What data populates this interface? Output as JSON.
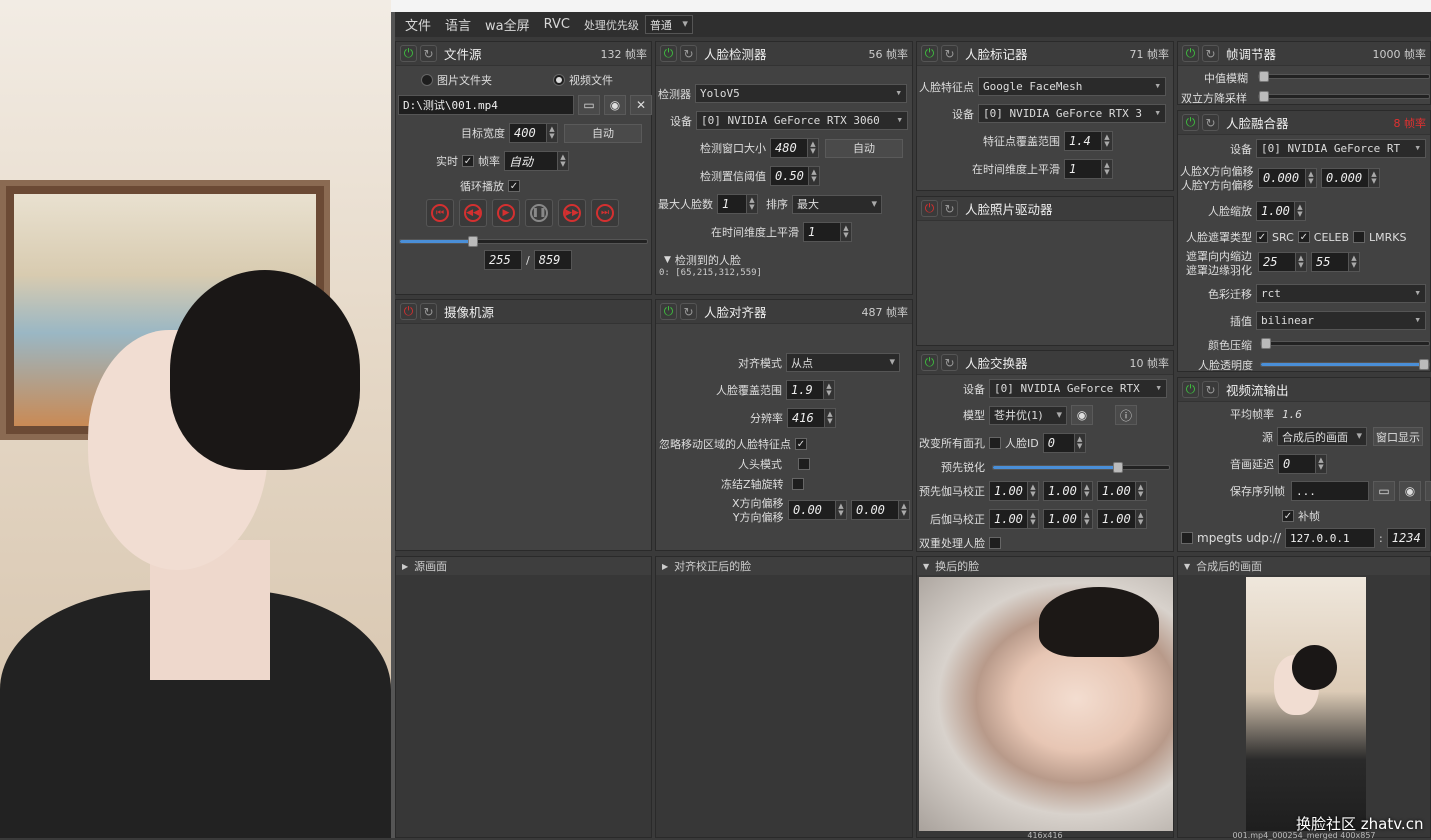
{
  "menu": {
    "items": [
      "文件",
      "语言",
      "wa全屏",
      "RVC"
    ],
    "priority_label": "处理优先级",
    "priority_value": "普通"
  },
  "file_source": {
    "title": "文件源",
    "fps": "132 帧率",
    "radio_folder": "图片文件夹",
    "radio_video": "视频文件",
    "path": "D:\\测试\\001.mp4",
    "target_width_label": "目标宽度",
    "target_width": "400",
    "auto_label": "自动",
    "realtime_label": "实时",
    "fps_label": "帧率",
    "fps_value": "自动",
    "loop_label": "循环播放",
    "frame_current": "255",
    "frame_total": "859",
    "frame_sep": "/",
    "progress": 0.296
  },
  "camera_source": {
    "title": "摄像机源"
  },
  "face_detector": {
    "title": "人脸检测器",
    "fps": "56 帧率",
    "detector_label": "检测器",
    "detector_value": "YoloV5",
    "device_label": "设备",
    "device_value": "[0] NVIDIA GeForce RTX 3060",
    "window_label": "检测窗口大小",
    "window_value": "480",
    "auto_label": "自动",
    "threshold_label": "检测置信阈值",
    "threshold_value": "0.50",
    "max_faces_label": "最大人脸数",
    "max_faces_value": "1",
    "sort_label": "排序",
    "sort_value": "最大",
    "temporal_label": "在时间维度上平滑",
    "temporal_value": "1",
    "detected_label": "检测到的人脸",
    "detected_value": "0: [65,215,312,559]"
  },
  "face_marker": {
    "title": "人脸标记器",
    "fps": "71 帧率",
    "landmarks_label": "人脸特征点",
    "landmarks_value": "Google FaceMesh",
    "device_label": "设备",
    "device_value": "[0] NVIDIA GeForce RTX 3",
    "coverage_label": "特征点覆盖范围",
    "coverage_value": "1.4",
    "temporal_label": "在时间维度上平滑",
    "temporal_value": "1"
  },
  "photo_driver": {
    "title": "人脸照片驱动器"
  },
  "frame_adjuster": {
    "title": "帧调节器",
    "fps": "1000 帧率",
    "median_label": "中值模糊",
    "bilateral_label": "双立方降采样"
  },
  "face_merger": {
    "title": "人脸融合器",
    "fps": "8 帧率",
    "device_label": "设备",
    "device_value": "[0] NVIDIA GeForce RT",
    "x_offset_label": "人脸X方向偏移",
    "y_offset_label": "人脸Y方向偏移",
    "x_offset_value": "0.000",
    "y_offset_value": "0.000",
    "scale_label": "人脸缩放",
    "scale_value": "1.00",
    "mask_type_label": "人脸遮罩类型",
    "mask_src": "SRC",
    "mask_celeb": "CELEB",
    "mask_lmrks": "LMRKS",
    "erode_label": "遮罩向内缩边",
    "blur_label": "遮罩边缘羽化",
    "erode_value": "25",
    "blur_value": "55",
    "color_transfer_label": "色彩迁移",
    "color_transfer_value": "rct",
    "interp_label": "插值",
    "interp_value": "bilinear",
    "color_compress_label": "颜色压缩",
    "opacity_label": "人脸透明度",
    "opacity": 1.0
  },
  "face_aligner": {
    "title": "人脸对齐器",
    "fps": "487 帧率",
    "align_mode_label": "对齐模式",
    "align_mode_value": "从点",
    "coverage_label": "人脸覆盖范围",
    "coverage_value": "1.9",
    "resolution_label": "分辨率",
    "resolution_value": "416",
    "exclude_moving_label": "忽略移动区域的人脸特征点",
    "head_mode_label": "人头模式",
    "freeze_z_label": "冻结Z轴旋转",
    "x_offset_label": "X方向偏移",
    "y_offset_label": "Y方向偏移",
    "x_offset_value": "0.00",
    "y_offset_value": "0.00"
  },
  "face_swapper": {
    "title": "人脸交换器",
    "fps": "10 帧率",
    "device_label": "设备",
    "device_value": "[0] NVIDIA GeForce RTX",
    "model_label": "模型",
    "model_value": "苍井优(1)",
    "morph_label": "改变所有面孔",
    "face_id_label": "人脸ID",
    "face_id_value": "0",
    "presharpen_label": "预先锐化",
    "presharpen": 0.71,
    "pre_gamma_label": "预先伽马校正",
    "post_gamma_label": "后伽马校正",
    "gamma_values": [
      "1.00",
      "1.00",
      "1.00"
    ],
    "post_gamma_values": [
      "1.00",
      "1.00",
      "1.00"
    ],
    "two_pass_label": "双重处理人脸"
  },
  "stream_output": {
    "title": "视频流输出",
    "avg_fps_label": "平均帧率",
    "avg_fps_value": "1.6",
    "source_label": "源",
    "source_value": "合成后的画面",
    "window_btn": "窗口显示",
    "delay_label": "音画延迟",
    "delay_value": "0",
    "save_seq_label": "保存序列帧",
    "save_path": "...",
    "fill_frames_label": "补帧",
    "mpegts_label": "mpegts udp://",
    "ip_value": "127.0.0.1",
    "port_sep": ":",
    "port_value": "1234"
  },
  "viewers": {
    "source": "源画面",
    "aligned": "对齐校正后的脸",
    "swapped": "换后的脸",
    "merged": "合成后的画面",
    "swapped_caption": "416x416",
    "merged_caption": "001.mp4_000254_merged 400x857"
  },
  "watermark": "换脸社区 zhatv.cn"
}
